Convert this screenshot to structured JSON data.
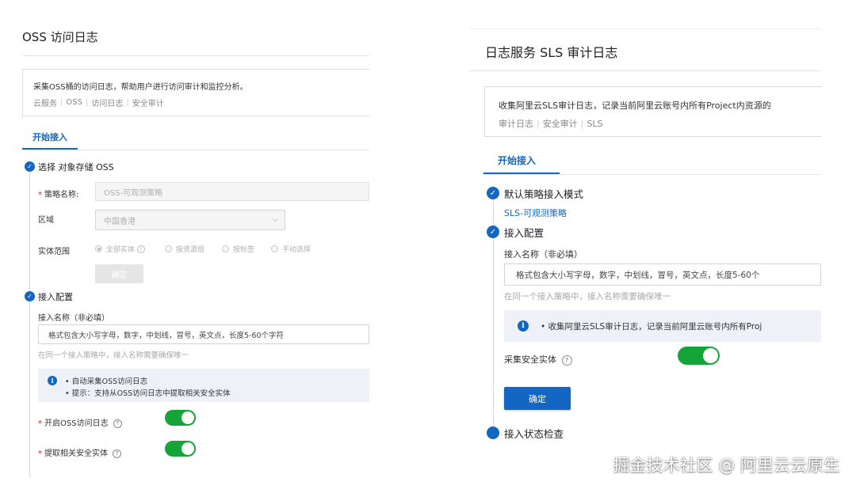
{
  "left_panel": {
    "title": "OSS 访问日志",
    "description": "采集OSS桶的访问日志，帮助用户进行访问审计和监控分析。",
    "tags": [
      "云服务",
      "OSS",
      "访问日志",
      "安全审计"
    ],
    "tab": "开始接入",
    "step1": {
      "label": "选择 对象存储 OSS",
      "policy_name_label": "策略名称:",
      "policy_name_value": "OSS-可观测策略",
      "region_label": "区域",
      "region_value": "中国香港",
      "scope_label": "实体范围",
      "scope_options": [
        "全部实体",
        "按资源组",
        "按标签",
        "手动选择"
      ],
      "confirm_label": "确定"
    },
    "step2": {
      "label": "接入配置",
      "name_label": "接入名称（非必填）",
      "name_placeholder": "格式包含大小写字母，数字，中划线，冒号，英文点，长度5-60个字符",
      "name_hint": "在同一个接入策略中，接入名称需要确保唯一",
      "info_lines": [
        "• 自动采集OSS访问日志",
        "• 提示：支持从OSS访问日志中提取相关安全实体"
      ],
      "toggle1_label": "开启OSS访问日志",
      "toggle1_on": true,
      "toggle2_label": "提取相关安全实体",
      "toggle2_on": true
    }
  },
  "right_panel": {
    "title": "日志服务 SLS 审计日志",
    "description": "收集阿里云SLS审计日志，记录当前阿里云账号内所有Project内资源的",
    "tags": [
      "审计日志",
      "安全审计",
      "SLS"
    ],
    "tab": "开始接入",
    "step1": {
      "label": "默认策略接入模式",
      "link": "SLS-可观测策略"
    },
    "step2": {
      "label": "接入配置",
      "name_label": "接入名称（非必填）",
      "name_placeholder": "格式包含大小写字母，数字，中划线，冒号，英文点，长度5-60个",
      "name_hint": "在同一个接入策略中，接入名称需要确保唯一",
      "info_line": "• 收集阿里云SLS审计日志，记录当前阿里云账号内所有Proj",
      "toggle_label": "采集安全实体",
      "toggle_on": true,
      "confirm_label": "确定"
    },
    "step3": {
      "label": "接入状态检查"
    }
  },
  "watermark": "掘金技术社区 @ 阿里云云原生",
  "colors": {
    "accent": "#1366c2",
    "toggle_on": "#15a33a",
    "required": "#e02020",
    "info_bg": "#eef2f8"
  },
  "icons": {
    "step_done": "check-circle-icon",
    "step_pending": "dot-circle-icon",
    "info": "info-icon",
    "help": "question-circle-icon",
    "dropdown": "chevron-down-icon"
  }
}
